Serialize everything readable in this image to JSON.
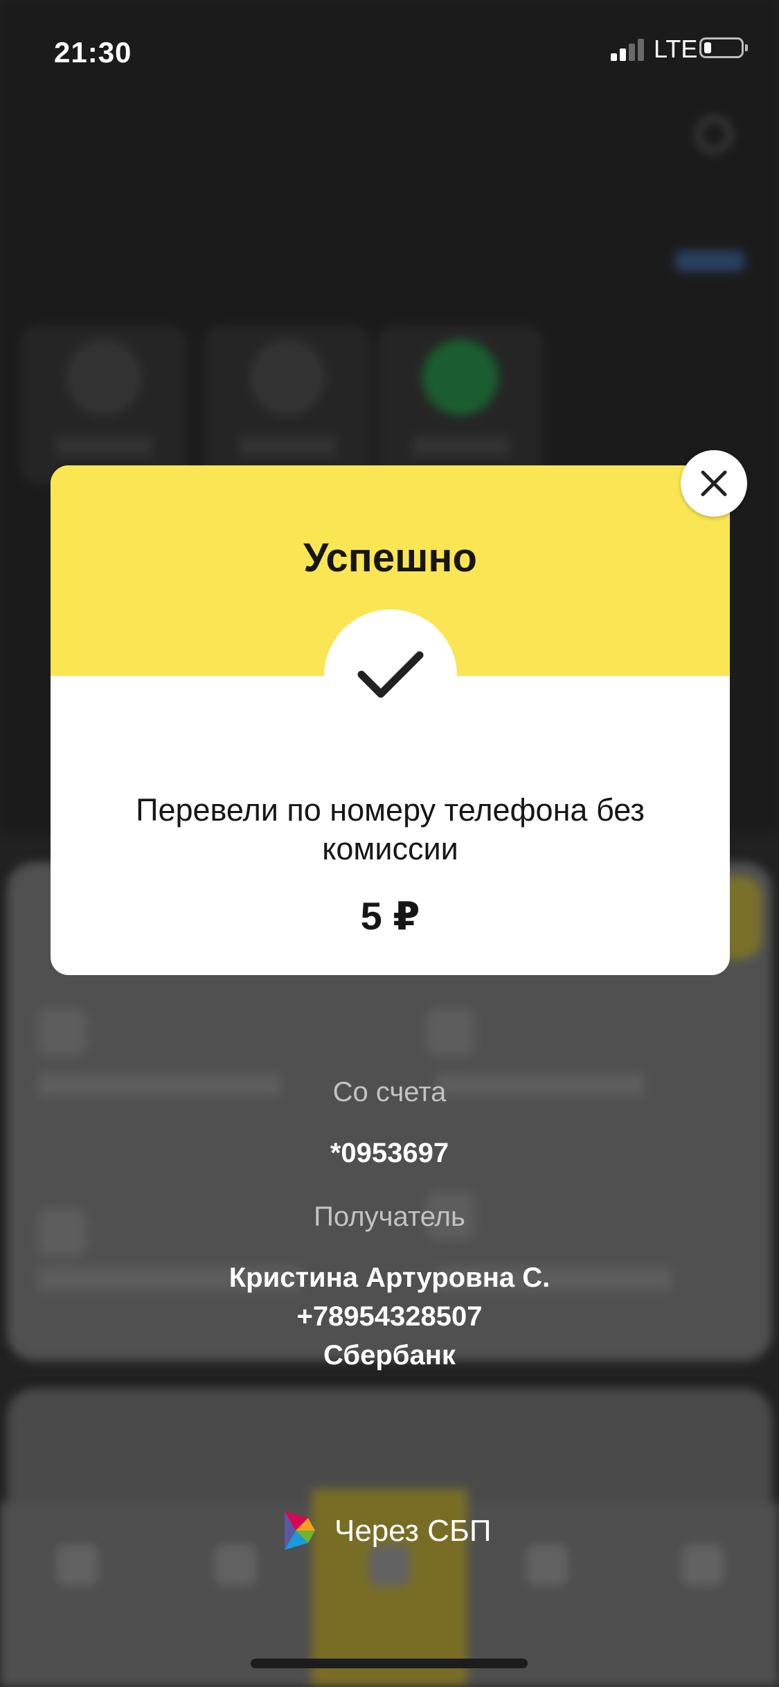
{
  "status_bar": {
    "time": "21:30",
    "network": "LTE",
    "signal_bars_active": 2,
    "signal_bars_total": 4,
    "battery_level": 0.2
  },
  "dialog": {
    "title": "Успешно",
    "message": "Перевели по номеру телефона без комиссии",
    "amount": "5 ₽",
    "header_color": "#fae553",
    "close_icon": "close-icon",
    "status_icon": "checkmark-icon"
  },
  "details": {
    "from_label": "Со счета",
    "from_account": "*0953697",
    "recipient_label": "Получатель",
    "recipient_name": "Кристина Артуровна С.",
    "recipient_phone": "+78954328507",
    "recipient_bank": "Сбербанк"
  },
  "payment_system": {
    "label": "Через СБП",
    "icon": "sbp-logo-icon"
  },
  "background_screen": {
    "tab_active_color": "#fae553",
    "favorite_accent_color": "#21a038"
  }
}
